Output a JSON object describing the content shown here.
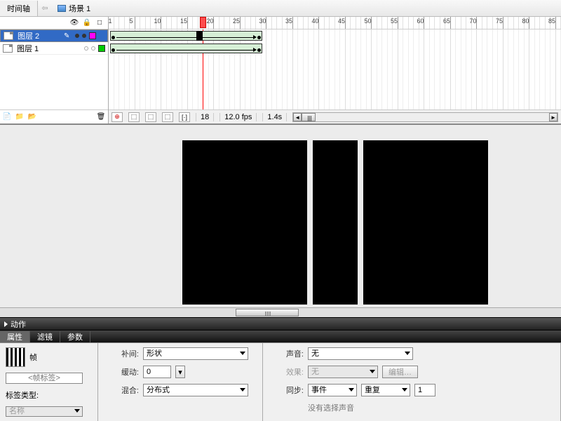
{
  "topbar": {
    "timeline_tab": "时间轴",
    "scene": "场景 1"
  },
  "layers": {
    "items": [
      {
        "name": "图层 2",
        "selected": true,
        "color": "magenta"
      },
      {
        "name": "图层 1",
        "selected": false,
        "color": "green"
      }
    ]
  },
  "ruler": {
    "start": 1,
    "end": 85,
    "step": 5
  },
  "playhead": {
    "frame": 18
  },
  "tl_footer": {
    "frame": "18",
    "fps": "12.0 fps",
    "time": "1.4s"
  },
  "actions_title": "动作",
  "tabs": {
    "props": "属性",
    "filters": "滤镜",
    "params": "参数"
  },
  "props": {
    "section_frame": "帧",
    "frame_label_ph": "<帧标签>",
    "label_type": "标签类型:",
    "label_type_val": "名称",
    "tween_lbl": "补间:",
    "tween_val": "形状",
    "ease_lbl": "缓动:",
    "ease_val": "0",
    "blend_lbl": "混合:",
    "blend_val": "分布式",
    "sound_lbl": "声音:",
    "sound_val": "无",
    "effect_lbl": "效果:",
    "effect_val": "无",
    "edit_btn": "编辑…",
    "sync_lbl": "同步:",
    "sync_val": "事件",
    "repeat_val": "重复",
    "repeat_n": "1",
    "nosound": "没有选择声音"
  }
}
